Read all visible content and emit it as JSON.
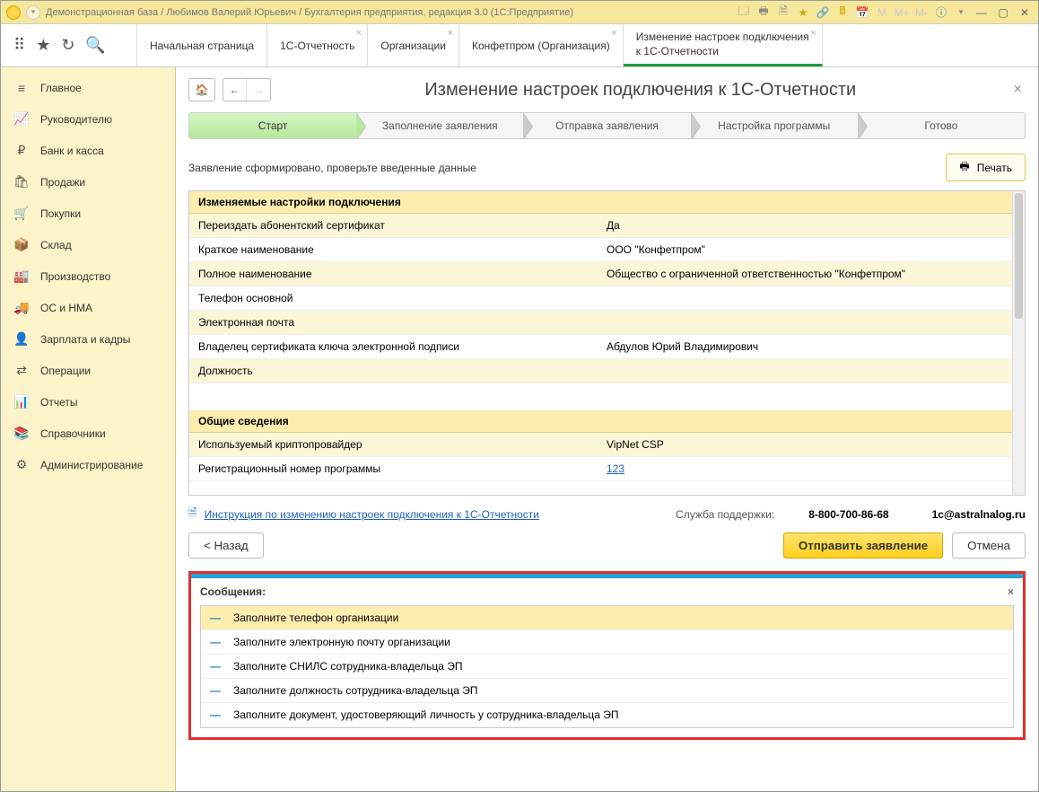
{
  "titlebar": {
    "text": "Демонстрационная база / Любимов Валерий Юрьевич / Бухгалтерия предприятия, редакция 3.0  (1С:Предприятие)"
  },
  "tabs": [
    {
      "label": "Начальная страница",
      "closable": false
    },
    {
      "label": "1С-Отчетность",
      "closable": true
    },
    {
      "label": "Организации",
      "closable": true
    },
    {
      "label": "Конфетпром (Организация)",
      "closable": true
    },
    {
      "label": "Изменение настроек подключения к 1С-Отчетности",
      "closable": true,
      "active": true
    }
  ],
  "sidebar": [
    {
      "icon": "≡",
      "label": "Главное"
    },
    {
      "icon": "📈",
      "label": "Руководителю"
    },
    {
      "icon": "₽",
      "label": "Банк и касса"
    },
    {
      "icon": "🛍",
      "label": "Продажи"
    },
    {
      "icon": "🛒",
      "label": "Покупки"
    },
    {
      "icon": "📦",
      "label": "Склад"
    },
    {
      "icon": "🏭",
      "label": "Производство"
    },
    {
      "icon": "🚚",
      "label": "ОС и НМА"
    },
    {
      "icon": "👤",
      "label": "Зарплата и кадры"
    },
    {
      "icon": "⇄",
      "label": "Операции"
    },
    {
      "icon": "📊",
      "label": "Отчеты"
    },
    {
      "icon": "📚",
      "label": "Справочники"
    },
    {
      "icon": "⚙",
      "label": "Администрирование"
    }
  ],
  "page": {
    "title": "Изменение настроек подключения к 1С-Отчетности",
    "steps": [
      "Старт",
      "Заполнение заявления",
      "Отправка заявления",
      "Настройка программы",
      "Готово"
    ],
    "status_text": "Заявление сформировано, проверьте введенные данные",
    "print_label": "Печать",
    "section1_title": "Изменяемые настройки подключения",
    "rows1": [
      {
        "k": "Переиздать абонентский сертификат",
        "v": "Да"
      },
      {
        "k": "Краткое наименование",
        "v": "ООО \"Конфетпром\""
      },
      {
        "k": "Полное наименование",
        "v": "Общество с ограниченной ответственностью \"Конфетпром\""
      },
      {
        "k": "Телефон основной",
        "v": ""
      },
      {
        "k": "Электронная почта",
        "v": ""
      },
      {
        "k": "Владелец сертификата ключа электронной подписи",
        "v": "Абдулов Юрий Владимирович"
      },
      {
        "k": "Должность",
        "v": ""
      }
    ],
    "section2_title": "Общие сведения",
    "rows2": [
      {
        "k": "Используемый криптопровайдер",
        "v": "VipNet CSP"
      },
      {
        "k": "Регистрационный номер программы",
        "v": "123",
        "link": true
      }
    ],
    "instruction_link": "Инструкция по изменению настроек подключения к 1С-Отчетности",
    "support_label": "Служба поддержки:",
    "support_phone": "8-800-700-86-68",
    "support_email": "1c@astralnalog.ru",
    "back_btn": "<  Назад",
    "submit_btn": "Отправить заявление",
    "cancel_btn": "Отмена"
  },
  "messages": {
    "title": "Сообщения:",
    "items": [
      "Заполните телефон организации",
      "Заполните электронную почту организации",
      "Заполните СНИЛС сотрудника-владельца ЭП",
      "Заполните должность сотрудника-владельца ЭП",
      "Заполните документ, удостоверяющий личность у сотрудника-владельца ЭП"
    ]
  }
}
